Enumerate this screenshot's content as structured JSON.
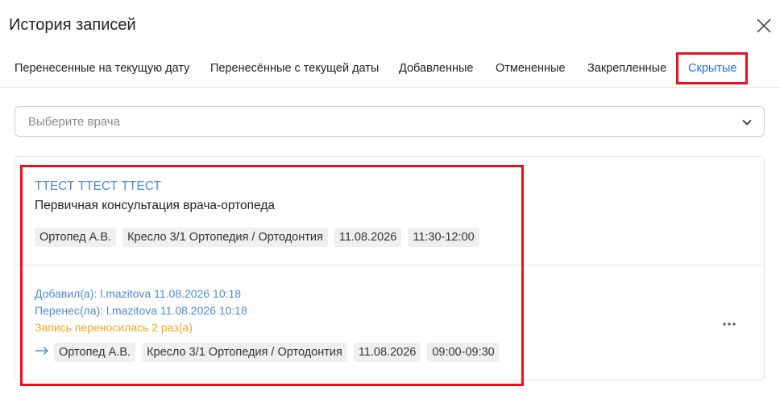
{
  "modal": {
    "title": "История записей"
  },
  "tabs": [
    {
      "label": "Перенесенные на текущую дату"
    },
    {
      "label": "Перенесённые с текущей даты"
    },
    {
      "label": "Добавленные"
    },
    {
      "label": "Отмененные"
    },
    {
      "label": "Закрепленные"
    },
    {
      "label": "Скрытые",
      "active": true
    }
  ],
  "doctor_select": {
    "placeholder": "Выберите врача"
  },
  "record": {
    "patient": "ТТЕСТ ТТЕСТ ТТЕСТ",
    "service": "Первичная консультация врача-ортопеда",
    "current": [
      "Ортопед А.В.",
      "Кресло 3/1 Ортопедия / Ортодонтия",
      "11.08.2026",
      "11:30-12:00"
    ],
    "added_by": "Добавил(а): l.mazitova 11.08.2026 10:18",
    "moved_by": "Перенес(ла): l.mazitova 11.08.2026 10:18",
    "moved_count": "Запись переносилась 2 раз(а)",
    "previous": [
      "Ортопед А.В.",
      "Кресло 3/1 Ортопедия / Ортодонтия",
      "11.08.2026",
      "09:00-09:30"
    ]
  },
  "colors": {
    "accent": "#1a73e8",
    "link": "#4a8ad8",
    "warning": "#f3a51b",
    "highlight": "#e8101c"
  },
  "icons": {
    "close": "close-icon",
    "chevron": "chevron-down-icon",
    "arrow": "arrow-right-icon",
    "more": "more-horizontal-icon"
  }
}
